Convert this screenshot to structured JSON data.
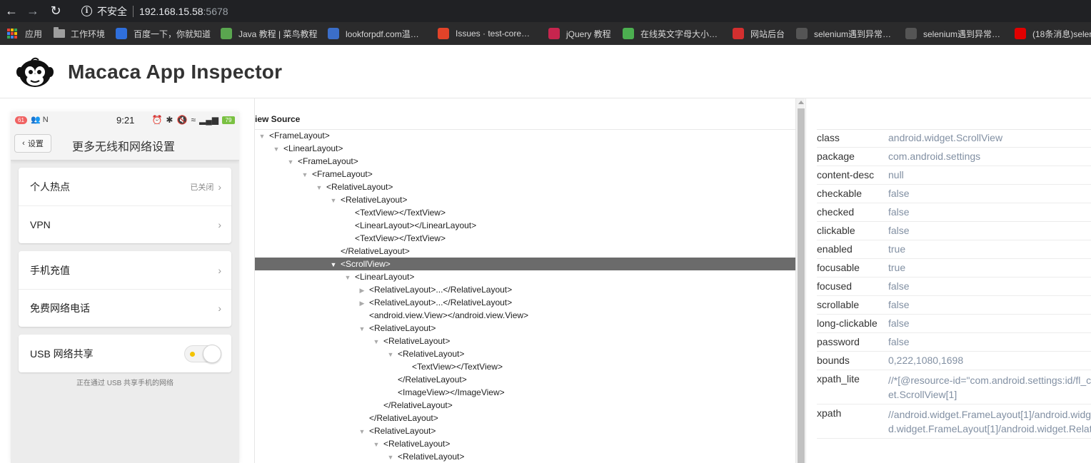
{
  "browser": {
    "security_label": "不安全",
    "url_host": "192.168.15.58",
    "url_port": ":5678",
    "bookmarks": [
      {
        "label": "应用",
        "icon": "apps-grid-icon"
      },
      {
        "label": "工作环境",
        "icon": "folder-icon"
      },
      {
        "label": "百度一下，你就知道",
        "icon": "baidu-icon",
        "color": "#2f6fdc"
      },
      {
        "label": "Java 教程 | 菜鸟教程",
        "icon": "runoob-icon",
        "color": "#5aa64f"
      },
      {
        "label": "lookforpdf.com温…",
        "icon": "pdf-icon",
        "color": "#3b6ec9"
      },
      {
        "label": "Issues · test-core…",
        "icon": "gitlab-icon",
        "color": "#e24329"
      },
      {
        "label": "jQuery 教程",
        "icon": "jquery-icon",
        "color": "#c7254e"
      },
      {
        "label": "在线英文字母大小…",
        "icon": "frog-icon",
        "color": "#4caf50"
      },
      {
        "label": "网站后台",
        "icon": "admin-icon",
        "color": "#d32f2f"
      },
      {
        "label": "selenium遇到异常…",
        "icon": "github-icon",
        "color": "#555"
      },
      {
        "label": "selenium遇到异常…",
        "icon": "github-icon",
        "color": "#555"
      },
      {
        "label": "(18条消息)seler",
        "icon": "csdn-icon",
        "color": "#e10000"
      }
    ]
  },
  "app": {
    "title": "Macaca App Inspector"
  },
  "phone": {
    "status": {
      "badge": "61",
      "time": "9:21",
      "battery": "79"
    },
    "back_label": "设置",
    "title": "更多无线和网络设置",
    "cards": [
      {
        "rows": [
          {
            "label": "个人热点",
            "value": "已关闭"
          },
          {
            "label": "VPN",
            "value": ""
          }
        ]
      },
      {
        "rows": [
          {
            "label": "手机充值",
            "value": ""
          },
          {
            "label": "免费网络电话",
            "value": ""
          }
        ]
      },
      {
        "rows": [
          {
            "label": "USB 网络共享",
            "value": ""
          }
        ]
      }
    ],
    "usb_note": "正在通过 USB 共享手机的网络"
  },
  "tree": {
    "header": "iew Source",
    "nodes": [
      {
        "text": "<FrameLayout>",
        "depth": 0,
        "toggle": "open"
      },
      {
        "text": "<LinearLayout>",
        "depth": 1,
        "toggle": "open"
      },
      {
        "text": "<FrameLayout>",
        "depth": 2,
        "toggle": "open"
      },
      {
        "text": "<FrameLayout>",
        "depth": 3,
        "toggle": "open"
      },
      {
        "text": "<RelativeLayout>",
        "depth": 4,
        "toggle": "open"
      },
      {
        "text": "<RelativeLayout>",
        "depth": 5,
        "toggle": "open"
      },
      {
        "text": "<TextView></TextView>",
        "depth": 6,
        "toggle": "none"
      },
      {
        "text": "<LinearLayout></LinearLayout>",
        "depth": 6,
        "toggle": "none"
      },
      {
        "text": "<TextView></TextView>",
        "depth": 6,
        "toggle": "none"
      },
      {
        "text": "</RelativeLayout>",
        "depth": 5,
        "toggle": "none"
      },
      {
        "text": "<ScrollView>",
        "depth": 5,
        "toggle": "open",
        "selected": true
      },
      {
        "text": "<LinearLayout>",
        "depth": 6,
        "toggle": "open"
      },
      {
        "text": "<RelativeLayout>...</RelativeLayout>",
        "depth": 7,
        "toggle": "closed"
      },
      {
        "text": "<RelativeLayout>...</RelativeLayout>",
        "depth": 7,
        "toggle": "closed"
      },
      {
        "text": "<android.view.View></android.view.View>",
        "depth": 7,
        "toggle": "none"
      },
      {
        "text": "<RelativeLayout>",
        "depth": 7,
        "toggle": "open"
      },
      {
        "text": "<RelativeLayout>",
        "depth": 8,
        "toggle": "open"
      },
      {
        "text": "<RelativeLayout>",
        "depth": 9,
        "toggle": "open"
      },
      {
        "text": "<TextView></TextView>",
        "depth": 10,
        "toggle": "none"
      },
      {
        "text": "</RelativeLayout>",
        "depth": 9,
        "toggle": "none"
      },
      {
        "text": "<ImageView></ImageView>",
        "depth": 9,
        "toggle": "none"
      },
      {
        "text": "</RelativeLayout>",
        "depth": 8,
        "toggle": "none"
      },
      {
        "text": "</RelativeLayout>",
        "depth": 7,
        "toggle": "none"
      },
      {
        "text": "<RelativeLayout>",
        "depth": 7,
        "toggle": "open"
      },
      {
        "text": "<RelativeLayout>",
        "depth": 8,
        "toggle": "open"
      },
      {
        "text": "<RelativeLayout>",
        "depth": 9,
        "toggle": "open"
      }
    ]
  },
  "attributes": [
    {
      "key": "class",
      "value": "android.widget.ScrollView"
    },
    {
      "key": "package",
      "value": "com.android.settings"
    },
    {
      "key": "content-desc",
      "value": "null"
    },
    {
      "key": "checkable",
      "value": "false"
    },
    {
      "key": "checked",
      "value": "false"
    },
    {
      "key": "clickable",
      "value": "false"
    },
    {
      "key": "enabled",
      "value": "true"
    },
    {
      "key": "focusable",
      "value": "true"
    },
    {
      "key": "focused",
      "value": "false"
    },
    {
      "key": "scrollable",
      "value": "false"
    },
    {
      "key": "long-clickable",
      "value": "false"
    },
    {
      "key": "password",
      "value": "false"
    },
    {
      "key": "bounds",
      "value": "0,222,1080,1698"
    },
    {
      "key": "xpath_lite",
      "value": "//*[@resource-id=\"com.android.settings:id/fl_c",
      "value2": "et.ScrollView[1]"
    },
    {
      "key": "xpath",
      "value": "//android.widget.FrameLayout[1]/android.widg",
      "value2": "d.widget.FrameLayout[1]/android.widget.Relat"
    }
  ]
}
